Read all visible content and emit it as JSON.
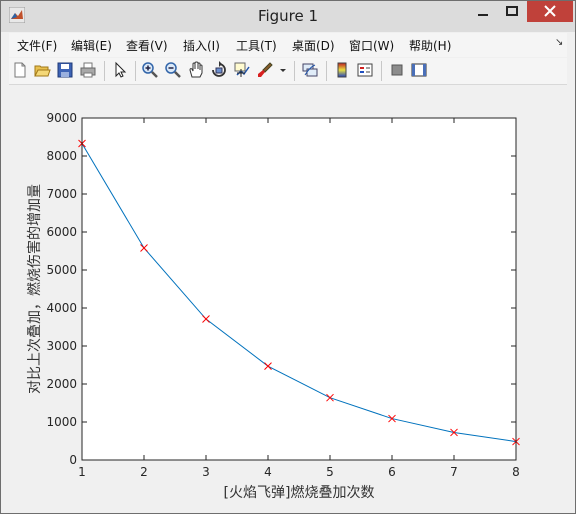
{
  "window": {
    "title": "Figure 1"
  },
  "menu": [
    "文件(F)",
    "编辑(E)",
    "查看(V)",
    "插入(I)",
    "工具(T)",
    "桌面(D)",
    "窗口(W)",
    "帮助(H)"
  ],
  "toolbar": [
    "new-figure-icon",
    "open-icon",
    "save-icon",
    "print-icon",
    "pointer-icon",
    "zoom-in-icon",
    "zoom-out-icon",
    "pan-icon",
    "rotate-3d-icon",
    "data-cursor-icon",
    "brush-icon",
    "link-plot-icon",
    "colorbar-icon",
    "legend-icon",
    "hide-plot-tools-icon",
    "show-plot-tools-icon"
  ],
  "chart_data": {
    "type": "line",
    "title": "",
    "xlabel": "[火焰飞弹]燃烧叠加次数",
    "ylabel": "对比上次叠加，燃烧伤害的增加量",
    "x": [
      1,
      2,
      3,
      4,
      5,
      6,
      7,
      8
    ],
    "y": [
      8330,
      5580,
      3710,
      2470,
      1640,
      1090,
      725,
      485
    ],
    "xlim": [
      1,
      8
    ],
    "ylim": [
      0,
      9000
    ],
    "xticks": [
      "1",
      "2",
      "3",
      "4",
      "5",
      "6",
      "7",
      "8"
    ],
    "yticks": [
      "0",
      "1000",
      "2000",
      "3000",
      "4000",
      "5000",
      "6000",
      "7000",
      "8000",
      "9000"
    ],
    "line_color": "#0072bd",
    "marker": "x",
    "marker_color": "#ff0000",
    "grid": false
  }
}
